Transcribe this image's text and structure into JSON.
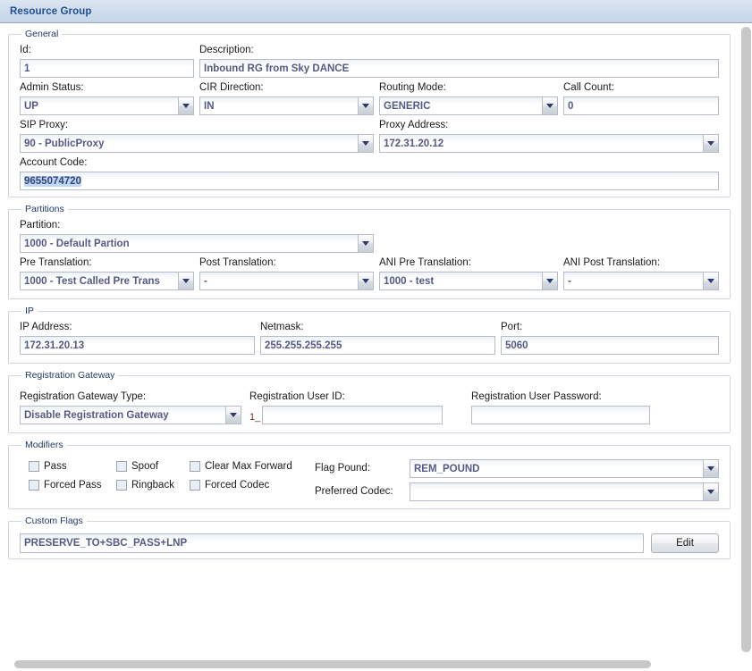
{
  "window": {
    "title": "Resource Group"
  },
  "groups": {
    "general": {
      "legend": "General",
      "id": {
        "label": "Id:",
        "value": "1"
      },
      "description": {
        "label": "Description:",
        "value": "Inbound RG from Sky DANCE"
      },
      "admin_status": {
        "label": "Admin Status:",
        "value": "UP"
      },
      "cir_direction": {
        "label": "CIR Direction:",
        "value": "IN"
      },
      "routing_mode": {
        "label": "Routing Mode:",
        "value": "GENERIC"
      },
      "call_count": {
        "label": "Call Count:",
        "value": "0"
      },
      "sip_proxy": {
        "label": "SIP Proxy:",
        "value": "90 - PublicProxy"
      },
      "proxy_address": {
        "label": "Proxy Address:",
        "value": "172.31.20.12"
      },
      "account_code": {
        "label": "Account Code:",
        "value": "9655074720"
      }
    },
    "partitions": {
      "legend": "Partitions",
      "partition": {
        "label": "Partition:",
        "value": "1000 - Default Partion"
      },
      "pre_translation": {
        "label": "Pre Translation:",
        "value": "1000 - Test Called Pre Trans"
      },
      "post_translation": {
        "label": "Post Translation:",
        "value": "-"
      },
      "ani_pre_translation": {
        "label": "ANI Pre Translation:",
        "value": "1000 - test"
      },
      "ani_post_translation": {
        "label": "ANI Post Translation:",
        "value": "-"
      }
    },
    "ip": {
      "legend": "IP",
      "ip_address": {
        "label": "IP Address:",
        "value": "172.31.20.13"
      },
      "netmask": {
        "label": "Netmask:",
        "value": "255.255.255.255"
      },
      "port": {
        "label": "Port:",
        "value": "5060"
      }
    },
    "registration_gateway": {
      "legend": "Registration Gateway",
      "gateway_type": {
        "label": "Registration Gateway Type:",
        "value": "Disable Registration Gateway"
      },
      "user_id": {
        "label": "Registration User ID:",
        "value": "",
        "prefix": "1_"
      },
      "user_password": {
        "label": "Registration User Password:",
        "value": ""
      }
    },
    "modifiers": {
      "legend": "Modifiers",
      "checkboxes": [
        {
          "label": "Pass",
          "checked": false
        },
        {
          "label": "Spoof",
          "checked": false
        },
        {
          "label": "Clear Max Forward",
          "checked": false
        },
        {
          "label": "Forced Pass",
          "checked": false
        },
        {
          "label": "Ringback",
          "checked": false
        },
        {
          "label": "Forced Codec",
          "checked": false
        }
      ],
      "flag_pound": {
        "label": "Flag Pound:",
        "value": "REM_POUND"
      },
      "preferred_codec": {
        "label": "Preferred Codec:",
        "value": ""
      }
    },
    "custom_flags": {
      "legend": "Custom Flags",
      "value": "PRESERVE_TO+SBC_PASS+LNP",
      "edit_button": "Edit"
    }
  },
  "colors": {
    "title_text": "#1f4e93",
    "field_text": "#545a86",
    "legend_text": "#1f3864",
    "selection": "#bcd9f5"
  }
}
